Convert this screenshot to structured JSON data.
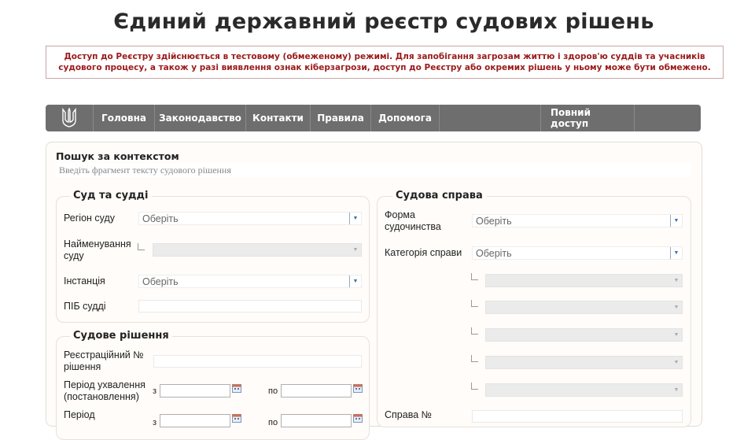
{
  "header": {
    "title": "Єдиний державний реєстр судових рішень",
    "notice": "Доступ до Реєстру здійснюється в тестовому (обмеженому) режимі. Для запобігання загрозам життю і здоров'ю суддів та учасників судового процесу, а також у разі виявлення ознак кіберзагрози, доступ до Реєстру або окремих рішень у ньому може бути обмежено."
  },
  "nav": {
    "items": [
      "Головна",
      "Законодавство",
      "Контакти",
      "Правила",
      "Допомога",
      "Повний доступ"
    ]
  },
  "search": {
    "context_label": "Пошук за контекстом",
    "context_placeholder": "Введіть фрагмент тексту судового рішення"
  },
  "court_group": {
    "title": "Суд та судді",
    "region_label": "Регіон суду",
    "region_value": "Оберіть",
    "name_label": "Найменування суду",
    "instance_label": "Інстанція",
    "instance_value": "Оберіть",
    "judge_label": "ПІБ судді"
  },
  "decision_group": {
    "title": "Судове рішення",
    "reg_label": "Реєстраційний № рішення",
    "period_adopt_label": "Період ухвалення (постановлення)",
    "period_reg_label": "Період",
    "from": "з",
    "to": "по"
  },
  "case_group": {
    "title": "Судова справа",
    "form_label": "Форма судочинства",
    "form_value": "Оберіть",
    "category_label": "Категорія справи",
    "category_value": "Оберіть",
    "case_no_label": "Справа №"
  }
}
